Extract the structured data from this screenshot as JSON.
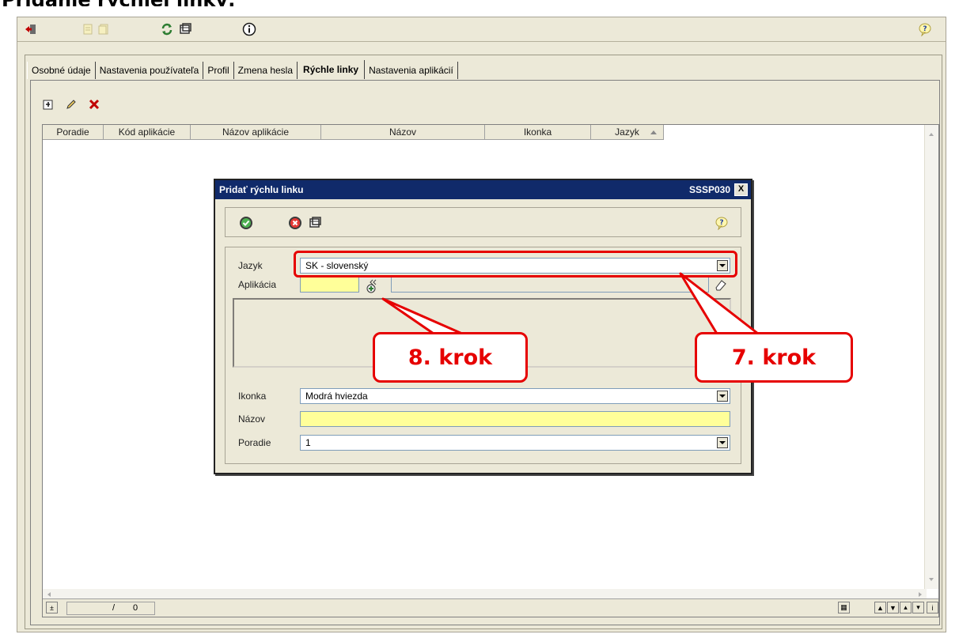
{
  "page_heading": "Pridanie rýchlej linky:",
  "toolbar_icons": [
    "exit-icon",
    "new-document-icon",
    "copy-document-icon",
    "refresh-icon",
    "window-icon",
    "info-icon",
    "help-icon"
  ],
  "tabs": [
    {
      "label": "Osobné údaje",
      "active": false
    },
    {
      "label": "Nastavenia používateľa",
      "active": false
    },
    {
      "label": "Profil",
      "active": false
    },
    {
      "label": "Zmena hesla",
      "active": false
    },
    {
      "label": "Rýchle linky",
      "active": true
    },
    {
      "label": "Nastavenia aplikácií",
      "active": false
    }
  ],
  "sub_toolbar_icons": [
    "add-record-icon",
    "edit-pencil-icon",
    "delete-x-icon"
  ],
  "grid": {
    "columns": [
      "Poradie",
      "Kód aplikácie",
      "Názov aplikácie",
      "Názov",
      "Ikonka",
      "Jazyk"
    ],
    "sort_column": "Jazyk",
    "sort_direction": "ascending"
  },
  "status": {
    "record_position": "/",
    "record_total": "0"
  },
  "modal": {
    "title": "Pridať rýchlu linku",
    "code": "SSSP030",
    "close_label": "X",
    "form": {
      "language_label": "Jazyk",
      "language_value": "SK - slovenský",
      "application_label": "Aplikácia",
      "application_code": "",
      "application_name": "",
      "icon_label": "Ikonka",
      "icon_value": "Modrá hviezda",
      "name_label": "Názov",
      "name_value": "",
      "order_label": "Poradie",
      "order_value": "1"
    }
  },
  "annotations": {
    "step7": "7. krok",
    "step8": "8. krok",
    "color": "#e60000"
  }
}
